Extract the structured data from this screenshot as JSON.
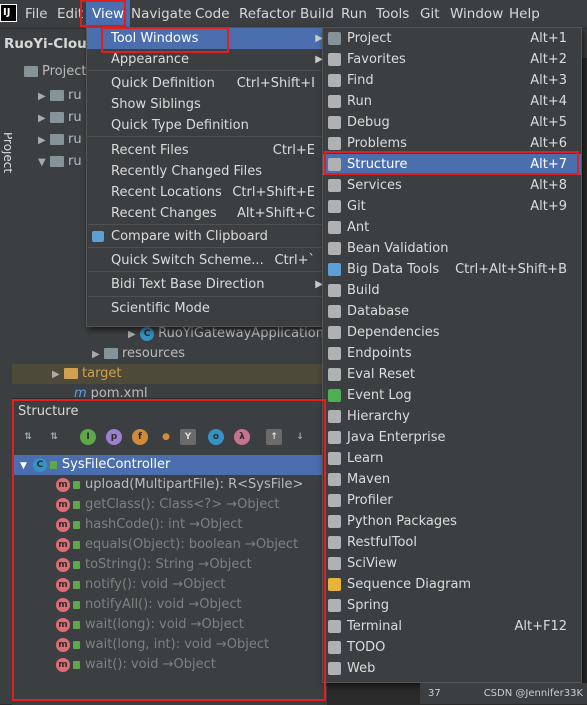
{
  "menubar": {
    "logo": "IJ",
    "items": [
      "File",
      "Edit",
      "View",
      "Navigate",
      "Code",
      "Refactor",
      "Build",
      "Run",
      "Tools",
      "Git",
      "Window",
      "Help"
    ]
  },
  "nav": {
    "project_name": "RuoYi-Cloud",
    "side_label": "Project",
    "project_tab": "Project"
  },
  "project_tree": {
    "rows": [
      "ru",
      "ru",
      "ru",
      "ru"
    ],
    "gateway_app": "RuoYiGatewayApplication",
    "resources": "resources",
    "target": "target",
    "pom": "pom.xml"
  },
  "view_menu": [
    {
      "label": "Tool Windows",
      "shortcut": "",
      "submenu": true
    },
    {
      "label": "Appearance",
      "shortcut": "",
      "submenu": true
    },
    {
      "label": "Quick Definition",
      "shortcut": "Ctrl+Shift+I"
    },
    {
      "label": "Show Siblings",
      "shortcut": ""
    },
    {
      "label": "Quick Type Definition",
      "shortcut": ""
    },
    {
      "label": "Recent Files",
      "shortcut": "Ctrl+E"
    },
    {
      "label": "Recently Changed Files",
      "shortcut": ""
    },
    {
      "label": "Recent Locations",
      "shortcut": "Ctrl+Shift+E"
    },
    {
      "label": "Recent Changes",
      "shortcut": "Alt+Shift+C"
    },
    {
      "label": "Compare with Clipboard",
      "shortcut": ""
    },
    {
      "label": "Quick Switch Scheme...",
      "shortcut": "Ctrl+`"
    },
    {
      "label": "Bidi Text Base Direction",
      "shortcut": "",
      "submenu": true
    },
    {
      "label": "Scientific Mode",
      "shortcut": ""
    }
  ],
  "tool_windows": [
    {
      "label": "Project",
      "shortcut": "Alt+1",
      "icon": "folder-icon",
      "color": "#87939a"
    },
    {
      "label": "Favorites",
      "shortcut": "Alt+2",
      "icon": "star-icon",
      "color": "#afb1b3"
    },
    {
      "label": "Find",
      "shortcut": "Alt+3",
      "icon": "search-icon",
      "color": "#afb1b3"
    },
    {
      "label": "Run",
      "shortcut": "Alt+4",
      "icon": "play-icon",
      "color": "#afb1b3"
    },
    {
      "label": "Debug",
      "shortcut": "Alt+5",
      "icon": "bug-icon",
      "color": "#afb1b3"
    },
    {
      "label": "Problems",
      "shortcut": "Alt+6",
      "icon": "warning-icon",
      "color": "#afb1b3"
    },
    {
      "label": "Structure",
      "shortcut": "Alt+7",
      "icon": "structure-icon",
      "color": "#afb1b3"
    },
    {
      "label": "Services",
      "shortcut": "Alt+8",
      "icon": "services-icon",
      "color": "#afb1b3"
    },
    {
      "label": "Git",
      "shortcut": "Alt+9",
      "icon": "git-icon",
      "color": "#afb1b3"
    },
    {
      "label": "Ant",
      "shortcut": "",
      "icon": "ant-icon",
      "color": "#afb1b3"
    },
    {
      "label": "Bean Validation",
      "shortcut": "",
      "icon": "bean-icon",
      "color": "#afb1b3"
    },
    {
      "label": "Big Data Tools",
      "shortcut": "Ctrl+Alt+Shift+B",
      "icon": "bigdata-icon",
      "color": "#5c9fd7"
    },
    {
      "label": "Build",
      "shortcut": "",
      "icon": "hammer-icon",
      "color": "#afb1b3"
    },
    {
      "label": "Database",
      "shortcut": "",
      "icon": "database-icon",
      "color": "#afb1b3"
    },
    {
      "label": "Dependencies",
      "shortcut": "",
      "icon": "dependencies-icon",
      "color": "#afb1b3"
    },
    {
      "label": "Endpoints",
      "shortcut": "",
      "icon": "endpoints-icon",
      "color": "#afb1b3"
    },
    {
      "label": "Eval Reset",
      "shortcut": "",
      "icon": "reset-icon",
      "color": "#afb1b3"
    },
    {
      "label": "Event Log",
      "shortcut": "",
      "icon": "event-log-icon",
      "color": "#4caf50"
    },
    {
      "label": "Hierarchy",
      "shortcut": "",
      "icon": "hierarchy-icon",
      "color": "#afb1b3"
    },
    {
      "label": "Java Enterprise",
      "shortcut": "",
      "icon": "java-enterprise-icon",
      "color": "#afb1b3"
    },
    {
      "label": "Learn",
      "shortcut": "",
      "icon": "learn-icon",
      "color": "#afb1b3"
    },
    {
      "label": "Maven",
      "shortcut": "",
      "icon": "maven-icon",
      "color": "#afb1b3"
    },
    {
      "label": "Profiler",
      "shortcut": "",
      "icon": "profiler-icon",
      "color": "#afb1b3"
    },
    {
      "label": "Python Packages",
      "shortcut": "",
      "icon": "python-icon",
      "color": "#afb1b3"
    },
    {
      "label": "RestfulTool",
      "shortcut": "",
      "icon": "restful-icon",
      "color": "#afb1b3"
    },
    {
      "label": "SciView",
      "shortcut": "",
      "icon": "sciview-icon",
      "color": "#afb1b3"
    },
    {
      "label": "Sequence Diagram",
      "shortcut": "",
      "icon": "sequence-diagram-icon",
      "color": "#e8b339"
    },
    {
      "label": "Spring",
      "shortcut": "",
      "icon": "spring-icon",
      "color": "#afb1b3"
    },
    {
      "label": "Terminal",
      "shortcut": "Alt+F12",
      "icon": "terminal-icon",
      "color": "#afb1b3"
    },
    {
      "label": "TODO",
      "shortcut": "",
      "icon": "todo-icon",
      "color": "#afb1b3"
    },
    {
      "label": "Web",
      "shortcut": "",
      "icon": "web-icon",
      "color": "#afb1b3"
    }
  ],
  "structure": {
    "title": "Structure",
    "class_name": "SysFileController",
    "methods": [
      {
        "text": "upload(MultipartFile): R<SysFile>",
        "dim": false
      },
      {
        "text": "getClass(): Class<?> →Object",
        "dim": true
      },
      {
        "text": "hashCode(): int →Object",
        "dim": true
      },
      {
        "text": "equals(Object): boolean →Object",
        "dim": true
      },
      {
        "text": "toString(): String →Object",
        "dim": true
      },
      {
        "text": "notify(): void →Object",
        "dim": true
      },
      {
        "text": "notifyAll(): void →Object",
        "dim": true
      },
      {
        "text": "wait(long): void →Object",
        "dim": true
      },
      {
        "text": "wait(long, int): void →Object",
        "dim": true
      },
      {
        "text": "wait(): void →Object",
        "dim": true
      }
    ]
  },
  "status": {
    "line": "37",
    "watermark": "CSDN @Jennifer33K"
  }
}
